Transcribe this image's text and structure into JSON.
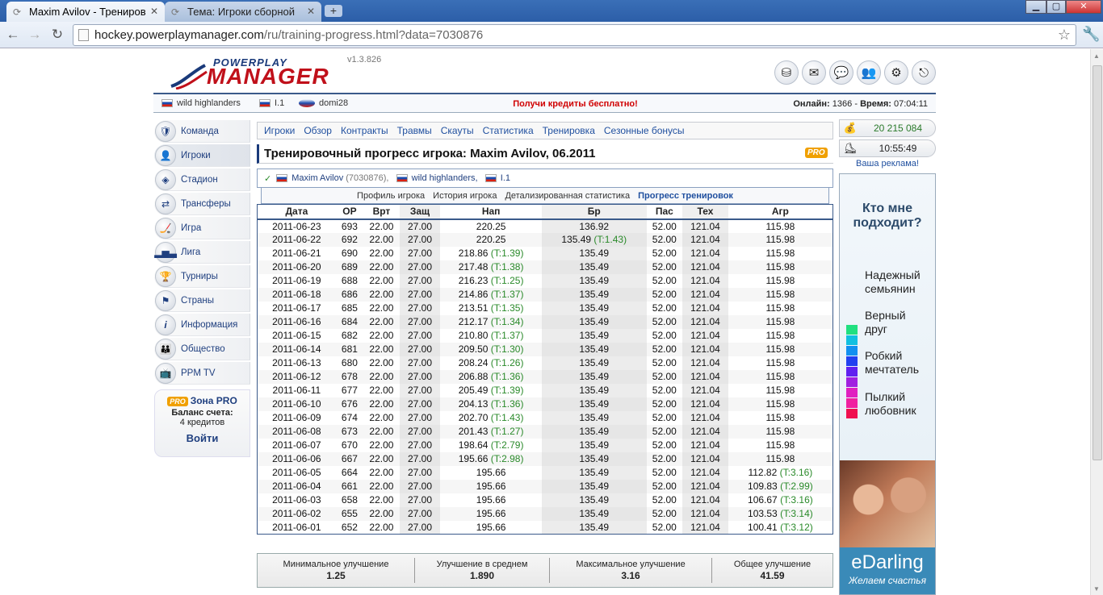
{
  "browser": {
    "tabs": [
      {
        "title": "Maxim Avilov - Трениров",
        "active": true
      },
      {
        "title": "Тема: Игроки сборной",
        "active": false
      }
    ],
    "new_tab": "+",
    "url_host": "hockey.powerplaymanager.com",
    "url_path": "/ru/training-progress.html?data=7030876",
    "controls": {
      "minimize": "▁",
      "maximize": "▢",
      "close": "✕"
    }
  },
  "header": {
    "logo_top": "POWERPLAY",
    "logo_main": "MANAGER",
    "version": "v1.3.826",
    "icons": [
      "ppm-icon",
      "mail-icon",
      "forum-icon",
      "friends-icon",
      "settings-icon",
      "logout-icon"
    ]
  },
  "userbar": {
    "team": "wild highlanders",
    "league": "I.1",
    "user": "domi28",
    "promo": "Получи кредиты бесплатно!",
    "online_label": "Онлайн:",
    "online_value": "1366",
    "time_label": "Время:",
    "time_value": "07:04:11"
  },
  "menu": [
    {
      "label": "Команда",
      "icon": "shield-icon"
    },
    {
      "label": "Игроки",
      "icon": "player-icon"
    },
    {
      "label": "Стадион",
      "icon": "stadium-icon"
    },
    {
      "label": "Трансферы",
      "icon": "transfer-icon"
    },
    {
      "label": "Игра",
      "icon": "game-icon"
    },
    {
      "label": "Лига",
      "icon": "podium-icon"
    },
    {
      "label": "Турниры",
      "icon": "trophy-icon"
    },
    {
      "label": "Страны",
      "icon": "flags-icon"
    },
    {
      "label": "Информация",
      "icon": "info-icon"
    },
    {
      "label": "Общество",
      "icon": "people-icon"
    },
    {
      "label": "PPM TV",
      "icon": "tv-icon"
    }
  ],
  "zone_pro": {
    "title": "Зона PRO",
    "pro": "PRO",
    "balance_label": "Баланс счета:",
    "balance_value": "4 кредитов",
    "login": "Войти"
  },
  "subnav": [
    "Игроки",
    "Обзор",
    "Контракты",
    "Травмы",
    "Скауты",
    "Статистика",
    "Тренировка",
    "Сезонные бонусы"
  ],
  "page_title": "Тренировочный прогресс игрока: Maxim Avilov, 06.2011",
  "pro_tag": "PRO",
  "player": {
    "name": "Maxim Avilov",
    "id": "(7030876),",
    "team": "wild highlanders,",
    "league": "I.1"
  },
  "player_tabs": [
    "Профиль игрока",
    "История игрока",
    "Детализированная статистика",
    "Прогресс тренировок"
  ],
  "table": {
    "headers": [
      "Дата",
      "ОР",
      "Врт",
      "Защ",
      "Нап",
      "Бр",
      "Пас",
      "Тех",
      "Агр"
    ],
    "rows": [
      [
        "2011-06-23",
        "693",
        "22.00",
        "27.00",
        "220.25",
        "",
        "136.92",
        "",
        "52.00",
        "121.04",
        "115.98",
        ""
      ],
      [
        "2011-06-22",
        "692",
        "22.00",
        "27.00",
        "220.25",
        "",
        "135.49",
        "(T:1.43)",
        "52.00",
        "121.04",
        "115.98",
        ""
      ],
      [
        "2011-06-21",
        "690",
        "22.00",
        "27.00",
        "218.86",
        "(T:1.39)",
        "135.49",
        "",
        "52.00",
        "121.04",
        "115.98",
        ""
      ],
      [
        "2011-06-20",
        "689",
        "22.00",
        "27.00",
        "217.48",
        "(T:1.38)",
        "135.49",
        "",
        "52.00",
        "121.04",
        "115.98",
        ""
      ],
      [
        "2011-06-19",
        "688",
        "22.00",
        "27.00",
        "216.23",
        "(T:1.25)",
        "135.49",
        "",
        "52.00",
        "121.04",
        "115.98",
        ""
      ],
      [
        "2011-06-18",
        "686",
        "22.00",
        "27.00",
        "214.86",
        "(T:1.37)",
        "135.49",
        "",
        "52.00",
        "121.04",
        "115.98",
        ""
      ],
      [
        "2011-06-17",
        "685",
        "22.00",
        "27.00",
        "213.51",
        "(T:1.35)",
        "135.49",
        "",
        "52.00",
        "121.04",
        "115.98",
        ""
      ],
      [
        "2011-06-16",
        "684",
        "22.00",
        "27.00",
        "212.17",
        "(T:1.34)",
        "135.49",
        "",
        "52.00",
        "121.04",
        "115.98",
        ""
      ],
      [
        "2011-06-15",
        "682",
        "22.00",
        "27.00",
        "210.80",
        "(T:1.37)",
        "135.49",
        "",
        "52.00",
        "121.04",
        "115.98",
        ""
      ],
      [
        "2011-06-14",
        "681",
        "22.00",
        "27.00",
        "209.50",
        "(T:1.30)",
        "135.49",
        "",
        "52.00",
        "121.04",
        "115.98",
        ""
      ],
      [
        "2011-06-13",
        "680",
        "22.00",
        "27.00",
        "208.24",
        "(T:1.26)",
        "135.49",
        "",
        "52.00",
        "121.04",
        "115.98",
        ""
      ],
      [
        "2011-06-12",
        "678",
        "22.00",
        "27.00",
        "206.88",
        "(T:1.36)",
        "135.49",
        "",
        "52.00",
        "121.04",
        "115.98",
        ""
      ],
      [
        "2011-06-11",
        "677",
        "22.00",
        "27.00",
        "205.49",
        "(T:1.39)",
        "135.49",
        "",
        "52.00",
        "121.04",
        "115.98",
        ""
      ],
      [
        "2011-06-10",
        "676",
        "22.00",
        "27.00",
        "204.13",
        "(T:1.36)",
        "135.49",
        "",
        "52.00",
        "121.04",
        "115.98",
        ""
      ],
      [
        "2011-06-09",
        "674",
        "22.00",
        "27.00",
        "202.70",
        "(T:1.43)",
        "135.49",
        "",
        "52.00",
        "121.04",
        "115.98",
        ""
      ],
      [
        "2011-06-08",
        "673",
        "22.00",
        "27.00",
        "201.43",
        "(T:1.27)",
        "135.49",
        "",
        "52.00",
        "121.04",
        "115.98",
        ""
      ],
      [
        "2011-06-07",
        "670",
        "22.00",
        "27.00",
        "198.64",
        "(T:2.79)",
        "135.49",
        "",
        "52.00",
        "121.04",
        "115.98",
        ""
      ],
      [
        "2011-06-06",
        "667",
        "22.00",
        "27.00",
        "195.66",
        "(T:2.98)",
        "135.49",
        "",
        "52.00",
        "121.04",
        "115.98",
        ""
      ],
      [
        "2011-06-05",
        "664",
        "22.00",
        "27.00",
        "195.66",
        "",
        "135.49",
        "",
        "52.00",
        "121.04",
        "112.82",
        "(T:3.16)"
      ],
      [
        "2011-06-04",
        "661",
        "22.00",
        "27.00",
        "195.66",
        "",
        "135.49",
        "",
        "52.00",
        "121.04",
        "109.83",
        "(T:2.99)"
      ],
      [
        "2011-06-03",
        "658",
        "22.00",
        "27.00",
        "195.66",
        "",
        "135.49",
        "",
        "52.00",
        "121.04",
        "106.67",
        "(T:3.16)"
      ],
      [
        "2011-06-02",
        "655",
        "22.00",
        "27.00",
        "195.66",
        "",
        "135.49",
        "",
        "52.00",
        "121.04",
        "103.53",
        "(T:3.14)"
      ],
      [
        "2011-06-01",
        "652",
        "22.00",
        "27.00",
        "195.66",
        "",
        "135.49",
        "",
        "52.00",
        "121.04",
        "100.41",
        "(T:3.12)"
      ]
    ]
  },
  "summary": [
    {
      "label": "Минимальное улучшение",
      "value": "1.25"
    },
    {
      "label": "Улучшение в среднем",
      "value": "1.890"
    },
    {
      "label": "Максимальное улучшение",
      "value": "3.16"
    },
    {
      "label": "Общее улучшение",
      "value": "41.59"
    }
  ],
  "right": {
    "money": "20 215 084",
    "clock": "10:55:49",
    "ad_link": "Ваша реклама!",
    "ad_question": "Кто мне подходит?",
    "ad_options": [
      "Надежный семьянин",
      "Верный друг",
      "Робкий мечтатель",
      "Пылкий любовник"
    ],
    "ad_swatches": [
      "#20e080",
      "#10c0e0",
      "#1090f0",
      "#2040f0",
      "#6020f0",
      "#a020e0",
      "#e020c0",
      "#f020a0",
      "#f01050"
    ],
    "ad_brand": "eDarling",
    "ad_slogan": "Желаем счастья"
  }
}
